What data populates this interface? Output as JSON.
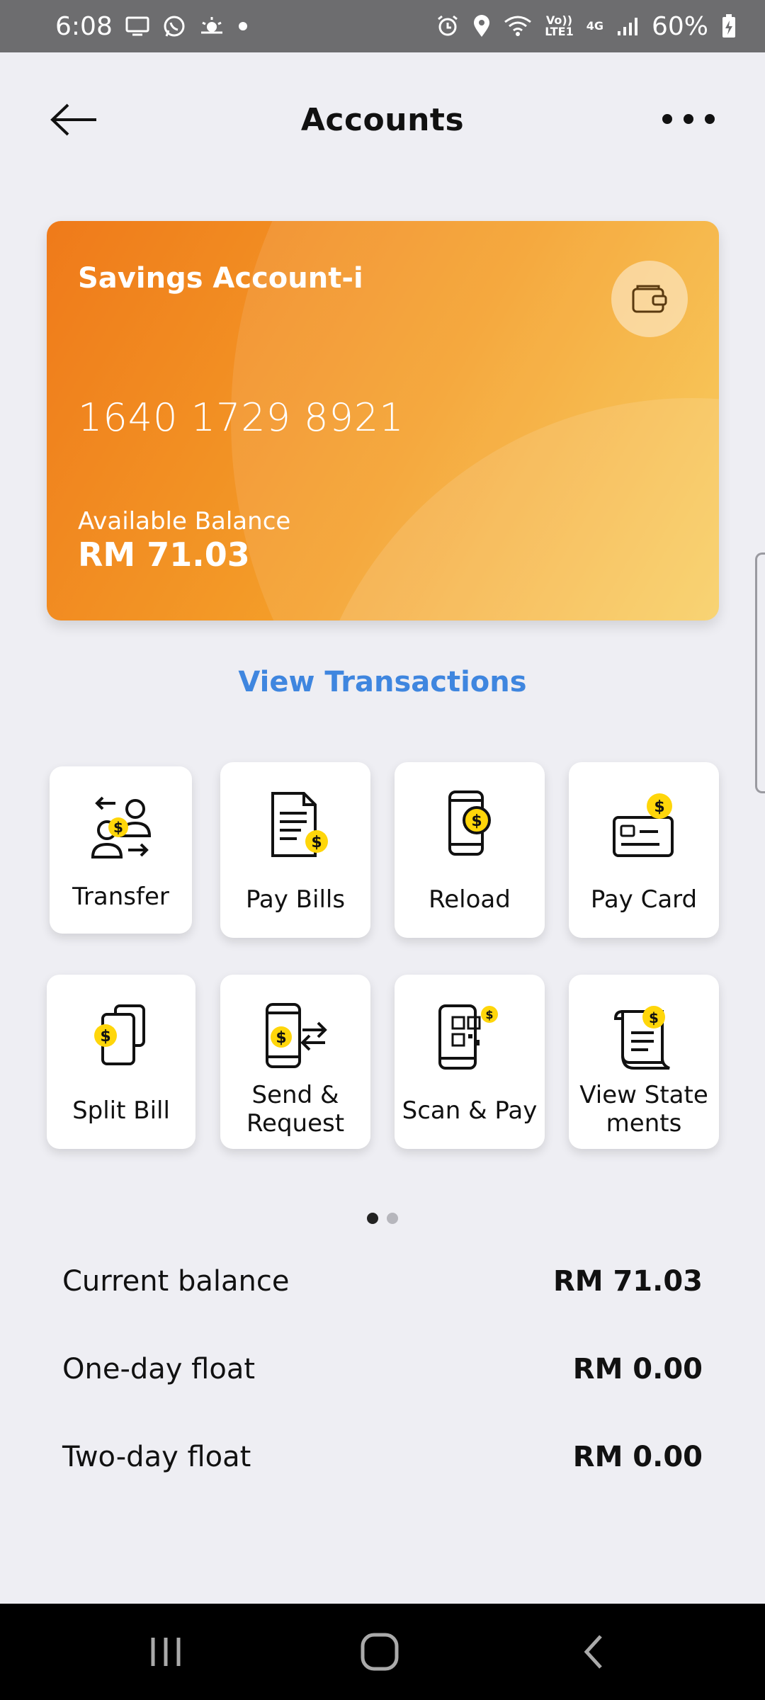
{
  "status_bar": {
    "time": "6:08",
    "network_top": "Vo))",
    "network_bottom": "LTE1",
    "net_type": "4G",
    "battery": "60%"
  },
  "header": {
    "title": "Accounts"
  },
  "card": {
    "account_name": "Savings Account-i",
    "account_number": "1640 1729 8921",
    "balance_label": "Available Balance",
    "balance_value": "RM 71.03",
    "gradient_colors": [
      "#ef7a1a",
      "#f7c94f"
    ]
  },
  "view_transactions": "View Transactions",
  "actions": [
    {
      "label": "Transfer",
      "icon": "transfer-icon"
    },
    {
      "label": "Pay Bills",
      "icon": "bill-icon"
    },
    {
      "label": "Reload",
      "icon": "reload-phone-icon"
    },
    {
      "label": "Pay Card",
      "icon": "credit-card-icon"
    },
    {
      "label": "Split Bill",
      "icon": "split-bill-icon"
    },
    {
      "label": "Send &\nRequest",
      "icon": "send-request-icon"
    },
    {
      "label": "Scan & Pay",
      "icon": "qr-scan-icon"
    },
    {
      "label": "View State\nments",
      "icon": "statement-icon"
    }
  ],
  "pager": {
    "pages": 2,
    "active": 1
  },
  "balances": [
    {
      "label": "Current balance",
      "value": "RM 71.03"
    },
    {
      "label": "One-day float",
      "value": "RM 0.00"
    },
    {
      "label": "Two-day float",
      "value": "RM 0.00"
    }
  ],
  "colors": {
    "accent_link": "#3f86df",
    "coin_yellow": "#ffd60a"
  }
}
